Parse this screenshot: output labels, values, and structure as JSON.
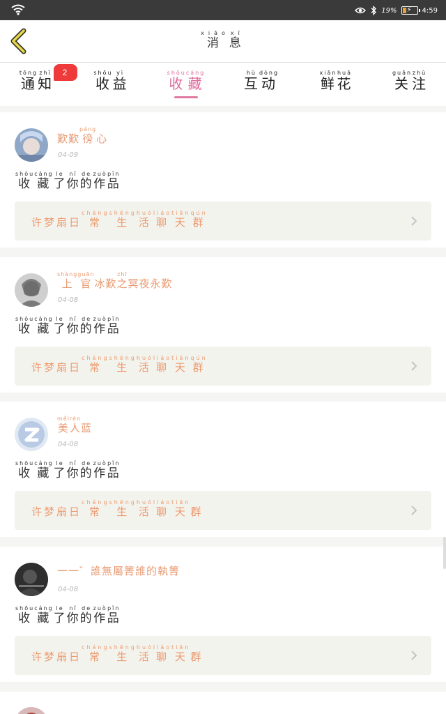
{
  "status_bar": {
    "battery": "19%",
    "time": "4:59",
    "icons": [
      "wifi-icon",
      "eye-icon",
      "bluetooth-icon",
      "battery-icon"
    ]
  },
  "header": {
    "title": "消息",
    "title_pinyin": [
      "xiāo",
      "xī"
    ],
    "back_icon": "chevron-left-icon"
  },
  "tabs": [
    {
      "label": "通知",
      "pinyin": [
        "tōng",
        "zhī"
      ],
      "badge": "2"
    },
    {
      "label": "收益",
      "pinyin": [
        "shōu",
        "yì"
      ]
    },
    {
      "label": "收藏",
      "pinyin": [
        "shōu",
        "cáng"
      ],
      "active": true
    },
    {
      "label": "互动",
      "pinyin": [
        "hù",
        "dòng"
      ]
    },
    {
      "label": "鲜花",
      "pinyin": [
        "xiān",
        "huā"
      ]
    },
    {
      "label": "关注",
      "pinyin": [
        "guān",
        "zhù"
      ]
    }
  ],
  "colors": {
    "accent": "#e06a9c",
    "username": "#e89a72",
    "work_title": "#ec9a6e",
    "badge": "#ee3a3a"
  },
  "messages": [
    {
      "username": "歎歎徬心",
      "username_pinyin": [
        "",
        "",
        "páng",
        ""
      ],
      "date": "04-09",
      "action": "收藏了你的作品",
      "action_pinyin": [
        "shōu",
        "cáng",
        "le",
        "nǐ",
        "de",
        "zuò",
        "pǐn"
      ],
      "work_title": "许梦扇日常生活聊天群",
      "work_pinyin": [
        "",
        "",
        "",
        "",
        "cháng",
        "shēng",
        "huó",
        "liáo",
        "tiān",
        "qún"
      ]
    },
    {
      "username": "上官冰歎之冥夜永歎",
      "username_pinyin": [
        "shàng",
        "guān",
        "",
        "",
        "zhī",
        "",
        "",
        "",
        ""
      ],
      "date": "04-08",
      "action": "收藏了你的作品",
      "action_pinyin": [
        "shōu",
        "cáng",
        "le",
        "nǐ",
        "de",
        "zuò",
        "pǐn"
      ],
      "work_title": "许梦扇日常生活聊天群",
      "work_pinyin": [
        "",
        "",
        "",
        "",
        "cháng",
        "shēng",
        "huó",
        "liáo",
        "tiān",
        "qún"
      ]
    },
    {
      "username": "美人蓝",
      "username_pinyin": [
        "měi",
        "rén",
        ""
      ],
      "date": "04-08",
      "action": "收藏了你的作品",
      "action_pinyin": [
        "shōu",
        "cáng",
        "le",
        "nǐ",
        "de",
        "zuò",
        "pǐn"
      ],
      "work_title": "许梦扇日常生活聊天群",
      "work_pinyin": [
        "",
        "",
        "",
        "",
        "cháng",
        "shēng",
        "huó",
        "liáo",
        "tiān",
        ""
      ]
    },
    {
      "username": "一一゛誰無屬箐誰的執箐",
      "username_pinyin": [],
      "date": "04-08",
      "action": "收藏了你的作品",
      "action_pinyin": [
        "shōu",
        "cáng",
        "le",
        "nǐ",
        "de",
        "zuò",
        "pǐn"
      ],
      "work_title": "许梦扇日常生活聊天群",
      "work_pinyin": [
        "",
        "",
        "",
        "",
        "cháng",
        "shēng",
        "huó",
        "liáo",
        "tiān",
        ""
      ]
    }
  ]
}
